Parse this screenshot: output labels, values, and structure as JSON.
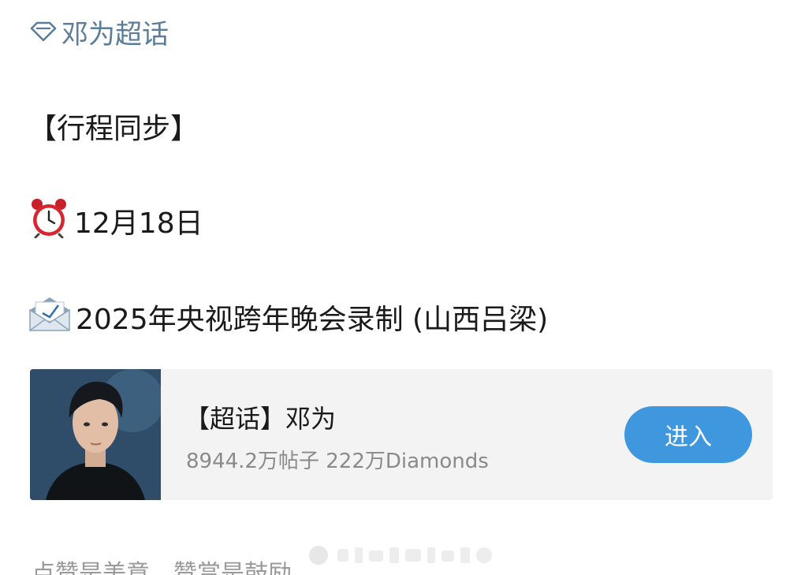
{
  "topic": {
    "label": "邓为超话",
    "icon": "diamond-icon",
    "color": "#5b7d99"
  },
  "post": {
    "heading": "【行程同步】",
    "date_icon": "alarm-clock-icon",
    "date": "12月18日",
    "event_icon": "envelope-icon",
    "event": "2025年央视跨年晚会录制 (山西吕梁)"
  },
  "card": {
    "title": "【超话】邓为",
    "stats": "8944.2万帖子 222万Diamonds",
    "button_label": "进入",
    "button_color": "#3f97de"
  },
  "footer": {
    "text": "点赞是美意，赞赏是鼓励"
  }
}
